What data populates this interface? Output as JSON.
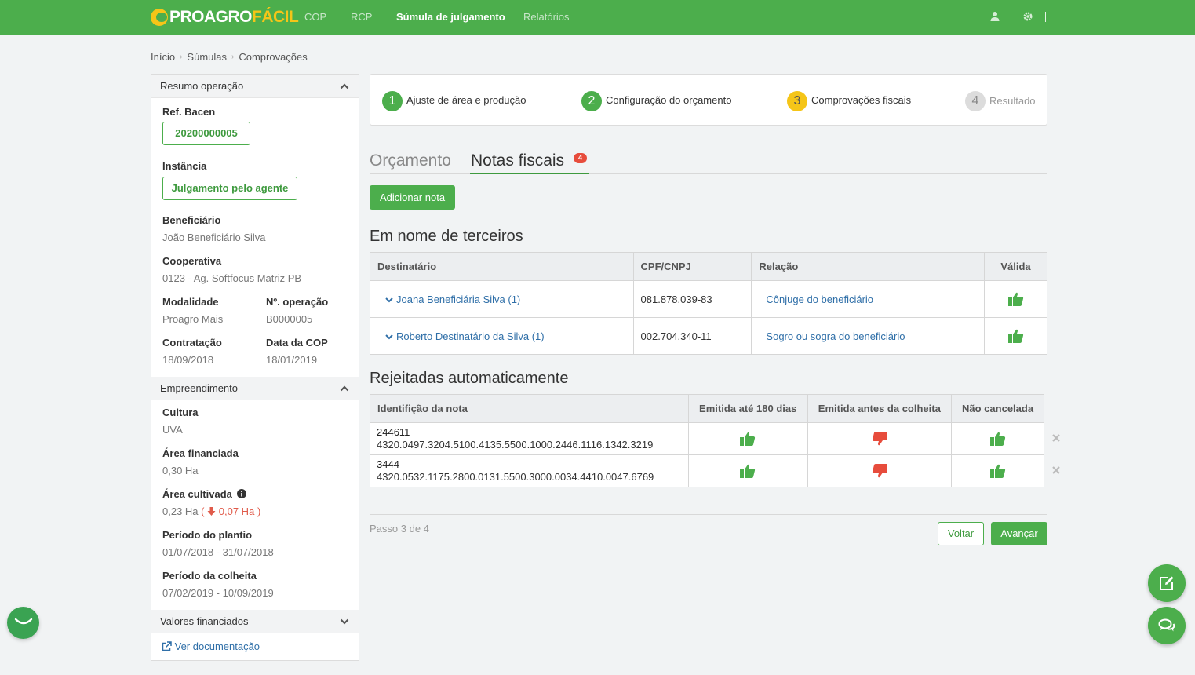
{
  "logo": {
    "part1": "PROAGRO",
    "part2": "FÁCIL"
  },
  "nav": {
    "items": [
      "COP",
      "RCP",
      "Súmula de julgamento",
      "Relatórios"
    ]
  },
  "breadcrumb": [
    "Início",
    "Súmulas",
    "Comprovações"
  ],
  "sidebar": {
    "resumo_title": "Resumo operação",
    "ref_bacen_label": "Ref. Bacen",
    "ref_bacen_value": "20200000005",
    "instancia_label": "Instância",
    "instancia_value": "Julgamento pelo agente",
    "beneficiario_label": "Beneficiário",
    "beneficiario_value": "João Beneficiário Silva",
    "cooperativa_label": "Cooperativa",
    "cooperativa_value": "0123 - Ag. Softfocus Matriz PB",
    "modalidade_label": "Modalidade",
    "modalidade_value": "Proagro Mais",
    "n_operacao_label": "Nº. operação",
    "n_operacao_value": "B0000005",
    "contratacao_label": "Contratação",
    "contratacao_value": "18/09/2018",
    "data_cop_label": "Data da COP",
    "data_cop_value": "18/01/2019",
    "empreendimento_title": "Empreendimento",
    "cultura_label": "Cultura",
    "cultura_value": "UVA",
    "area_financiada_label": "Área financiada",
    "area_financiada_value": "0,30 Ha",
    "area_cultivada_label": "Área cultivada",
    "area_cultivada_value": "0,23 Ha",
    "area_cultivada_open": "(",
    "area_cultivada_diff": "0,07 Ha",
    "area_cultivada_close": ")",
    "periodo_plantio_label": "Período do plantio",
    "periodo_plantio_value": "01/07/2018 - 31/07/2018",
    "periodo_colheita_label": "Período da colheita",
    "periodo_colheita_value": "07/02/2019 - 10/09/2019",
    "valores_title": "Valores financiados",
    "ver_doc": "Ver documentação"
  },
  "stepper": {
    "steps": [
      {
        "num": "1",
        "label": "Ajuste de área e produção"
      },
      {
        "num": "2",
        "label": "Configuração do orçamento"
      },
      {
        "num": "3",
        "label": "Comprovações fiscais"
      },
      {
        "num": "4",
        "label": "Resultado"
      }
    ]
  },
  "tabs": {
    "orcamento": "Orçamento",
    "notas": "Notas fiscais",
    "notas_badge": "4"
  },
  "add_button": "Adicionar nota",
  "terceiros": {
    "title": "Em nome de terceiros",
    "headers": [
      "Destinatário",
      "CPF/CNPJ",
      "Relação",
      "Válida"
    ],
    "rows": [
      {
        "destinatario": "Joana Beneficiária Silva (1)",
        "cpf": "081.878.039-83",
        "relacao": "Cônjuge do beneficiário"
      },
      {
        "destinatario": "Roberto Destinatário da Silva (1)",
        "cpf": "002.704.340-11",
        "relacao": "Sogro ou sogra do beneficiário"
      }
    ]
  },
  "rejeitadas": {
    "title": "Rejeitadas automaticamente",
    "headers": [
      "Identifição da nota",
      "Emitida até 180 dias",
      "Emitida antes da colheita",
      "Não cancelada"
    ],
    "rows": [
      {
        "numero": "244611",
        "chave": "4320.0497.3204.5100.4135.5500.1000.2446.1116.1342.3219"
      },
      {
        "numero": "3444",
        "chave": "4320.0532.1175.2800.0131.5500.3000.0034.4410.0047.6769"
      }
    ]
  },
  "footer": {
    "passo": "Passo 3 de 4",
    "voltar": "Voltar",
    "avancar": "Avançar"
  },
  "colors": {
    "green": "#4cae4c",
    "yellow": "#f5c518",
    "red": "#e74c3c",
    "link": "#2f6fa8"
  }
}
